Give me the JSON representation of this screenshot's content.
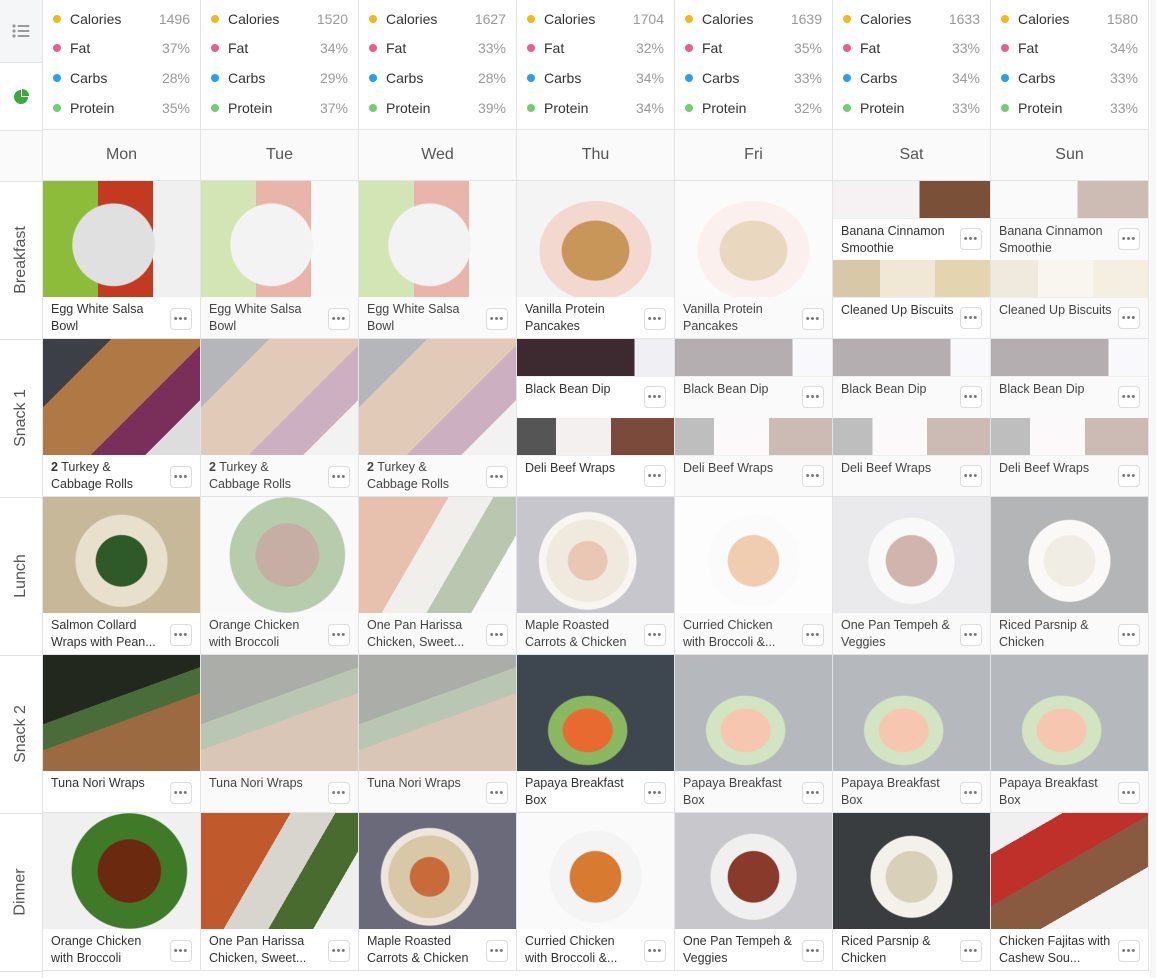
{
  "rail": {
    "list_icon": "list-icon",
    "pie_icon": "pie-chart-icon",
    "meal_labels": [
      "Breakfast",
      "Snack 1",
      "Lunch",
      "Snack 2",
      "Dinner"
    ]
  },
  "colors": {
    "calories": "#f5b81c",
    "fat": "#e5608a",
    "carbs": "#2a9ef0",
    "protein": "#6dcf6d",
    "pie": "#3aa83a"
  },
  "days": [
    {
      "name": "Mon",
      "summary": {
        "Calories": "1496",
        "Fat": "37%",
        "Carbs": "28%",
        "Protein": "35%"
      },
      "meals": [
        {
          "items": [
            {
              "title": "Egg White Salsa Bowl",
              "faded": false,
              "img": "egg-salsa"
            }
          ]
        },
        {
          "items": [
            {
              "qty": "2",
              "title": "Turkey & Cabbage Rolls",
              "faded": false,
              "img": "turkey-rolls"
            }
          ]
        },
        {
          "items": [
            {
              "title": "Salmon Collard Wraps with Pean...",
              "faded": false,
              "img": "collard"
            }
          ]
        },
        {
          "items": [
            {
              "title": "Tuna Nori Wraps",
              "faded": false,
              "img": "nori"
            }
          ]
        },
        {
          "items": [
            {
              "title": "Orange Chicken with Broccoli",
              "faded": false,
              "img": "orange-chicken"
            }
          ]
        }
      ]
    },
    {
      "name": "Tue",
      "summary": {
        "Calories": "1520",
        "Fat": "34%",
        "Carbs": "29%",
        "Protein": "37%"
      },
      "meals": [
        {
          "items": [
            {
              "title": "Egg White Salsa Bowl",
              "faded": true,
              "img": "egg-salsa"
            }
          ]
        },
        {
          "items": [
            {
              "qty": "2",
              "title": "Turkey & Cabbage Rolls",
              "faded": true,
              "img": "turkey-rolls"
            }
          ]
        },
        {
          "items": [
            {
              "title": "Orange Chicken with Broccoli",
              "faded": true,
              "img": "orange-chicken"
            }
          ]
        },
        {
          "items": [
            {
              "title": "Tuna Nori Wraps",
              "faded": true,
              "img": "nori"
            }
          ]
        },
        {
          "items": [
            {
              "title": "One Pan Harissa Chicken, Sweet...",
              "faded": false,
              "img": "harissa"
            }
          ]
        }
      ]
    },
    {
      "name": "Wed",
      "summary": {
        "Calories": "1627",
        "Fat": "33%",
        "Carbs": "28%",
        "Protein": "39%"
      },
      "meals": [
        {
          "items": [
            {
              "title": "Egg White Salsa Bowl",
              "faded": true,
              "img": "egg-salsa"
            }
          ]
        },
        {
          "items": [
            {
              "qty": "2",
              "title": "Turkey & Cabbage Rolls",
              "faded": true,
              "img": "turkey-rolls"
            }
          ]
        },
        {
          "items": [
            {
              "title": "One Pan Harissa Chicken, Sweet...",
              "faded": true,
              "img": "harissa"
            }
          ]
        },
        {
          "items": [
            {
              "title": "Tuna Nori Wraps",
              "faded": true,
              "img": "nori"
            }
          ]
        },
        {
          "items": [
            {
              "title": "Maple Roasted Carrots & Chicken",
              "faded": false,
              "img": "maple"
            }
          ]
        }
      ]
    },
    {
      "name": "Thu",
      "summary": {
        "Calories": "1704",
        "Fat": "32%",
        "Carbs": "34%",
        "Protein": "34%"
      },
      "meals": [
        {
          "items": [
            {
              "title": "Vanilla Protein Pancakes",
              "faded": false,
              "img": "pancakes"
            }
          ]
        },
        {
          "items": [
            {
              "title": "Black Bean Dip",
              "faded": false,
              "img": "bean-dip"
            },
            {
              "title": "Deli Beef Wraps",
              "faded": false,
              "img": "beef-wraps"
            }
          ]
        },
        {
          "items": [
            {
              "title": "Maple Roasted Carrots & Chicken",
              "faded": true,
              "img": "maple"
            }
          ]
        },
        {
          "items": [
            {
              "title": "Papaya Breakfast Box",
              "faded": false,
              "img": "papaya"
            }
          ]
        },
        {
          "items": [
            {
              "title": "Curried Chicken with Broccoli &...",
              "faded": false,
              "img": "curried"
            }
          ]
        }
      ]
    },
    {
      "name": "Fri",
      "summary": {
        "Calories": "1639",
        "Fat": "35%",
        "Carbs": "33%",
        "Protein": "32%"
      },
      "meals": [
        {
          "items": [
            {
              "title": "Vanilla Protein Pancakes",
              "faded": true,
              "img": "pancakes"
            }
          ]
        },
        {
          "items": [
            {
              "title": "Black Bean Dip",
              "faded": true,
              "img": "bean-dip"
            },
            {
              "title": "Deli Beef Wraps",
              "faded": true,
              "img": "beef-wraps"
            }
          ]
        },
        {
          "items": [
            {
              "title": "Curried Chicken with Broccoli &...",
              "faded": true,
              "img": "curried"
            }
          ]
        },
        {
          "items": [
            {
              "title": "Papaya Breakfast Box",
              "faded": true,
              "img": "papaya"
            }
          ]
        },
        {
          "items": [
            {
              "title": "One Pan Tempeh & Veggies",
              "faded": false,
              "img": "tempeh"
            }
          ]
        }
      ]
    },
    {
      "name": "Sat",
      "summary": {
        "Calories": "1633",
        "Fat": "33%",
        "Carbs": "34%",
        "Protein": "33%"
      },
      "meals": [
        {
          "items": [
            {
              "title": "Banana Cinnamon Smoothie",
              "faded": false,
              "img": "smoothie"
            },
            {
              "title": "Cleaned Up Biscuits",
              "faded": false,
              "img": "biscuits"
            }
          ]
        },
        {
          "items": [
            {
              "title": "Black Bean Dip",
              "faded": true,
              "img": "bean-dip"
            },
            {
              "title": "Deli Beef Wraps",
              "faded": true,
              "img": "beef-wraps"
            }
          ]
        },
        {
          "items": [
            {
              "title": "One Pan Tempeh & Veggies",
              "faded": true,
              "img": "tempeh"
            }
          ]
        },
        {
          "items": [
            {
              "title": "Papaya Breakfast Box",
              "faded": true,
              "img": "papaya"
            }
          ]
        },
        {
          "items": [
            {
              "title": "Riced Parsnip & Chicken",
              "faded": false,
              "img": "parsnip"
            }
          ]
        }
      ]
    },
    {
      "name": "Sun",
      "summary": {
        "Calories": "1580",
        "Fat": "34%",
        "Carbs": "33%",
        "Protein": "33%"
      },
      "meals": [
        {
          "items": [
            {
              "title": "Banana Cinnamon Smoothie",
              "faded": true,
              "img": "smoothie"
            },
            {
              "title": "Cleaned Up Biscuits",
              "faded": true,
              "img": "biscuits"
            }
          ]
        },
        {
          "items": [
            {
              "title": "Black Bean Dip",
              "faded": true,
              "img": "bean-dip"
            },
            {
              "title": "Deli Beef Wraps",
              "faded": true,
              "img": "beef-wraps"
            }
          ]
        },
        {
          "items": [
            {
              "title": "Riced Parsnip & Chicken",
              "faded": true,
              "img": "parsnip"
            }
          ]
        },
        {
          "items": [
            {
              "title": "Papaya Breakfast Box",
              "faded": true,
              "img": "papaya"
            }
          ]
        },
        {
          "items": [
            {
              "title": "Chicken Fajitas with Cashew Sou...",
              "faded": false,
              "img": "fajitas"
            }
          ]
        }
      ]
    }
  ],
  "more_label": "•••"
}
